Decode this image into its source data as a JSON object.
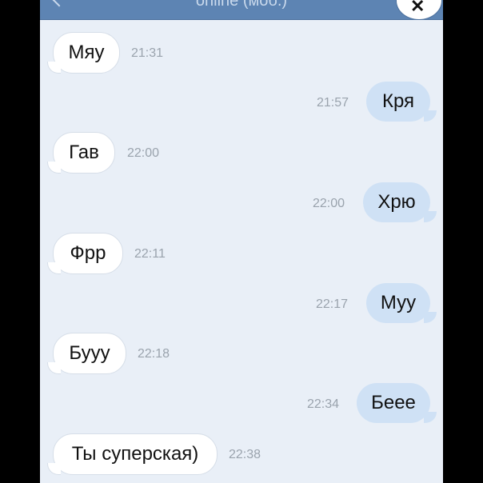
{
  "header": {
    "status": "online (моб.)",
    "avatar_icon": "avatar-photo"
  },
  "messages": [
    {
      "direction": "in",
      "text": "Мяу",
      "time": "21:31"
    },
    {
      "direction": "out",
      "text": "Кря",
      "time": "21:57"
    },
    {
      "direction": "in",
      "text": "Гав",
      "time": "22:00"
    },
    {
      "direction": "out",
      "text": "Хрю",
      "time": "22:00"
    },
    {
      "direction": "in",
      "text": "Фрр",
      "time": "22:11"
    },
    {
      "direction": "out",
      "text": "Муу",
      "time": "22:17"
    },
    {
      "direction": "in",
      "text": "Бууу",
      "time": "22:18"
    },
    {
      "direction": "out",
      "text": "Беее",
      "time": "22:34"
    },
    {
      "direction": "in",
      "text": "Ты суперская)",
      "time": "22:38"
    }
  ],
  "colors": {
    "background": "#e9eff7",
    "incoming_bubble": "#ffffff",
    "outgoing_bubble": "#cfe1f5",
    "header": "#5d84b3",
    "timestamp": "#9aa3ad"
  }
}
